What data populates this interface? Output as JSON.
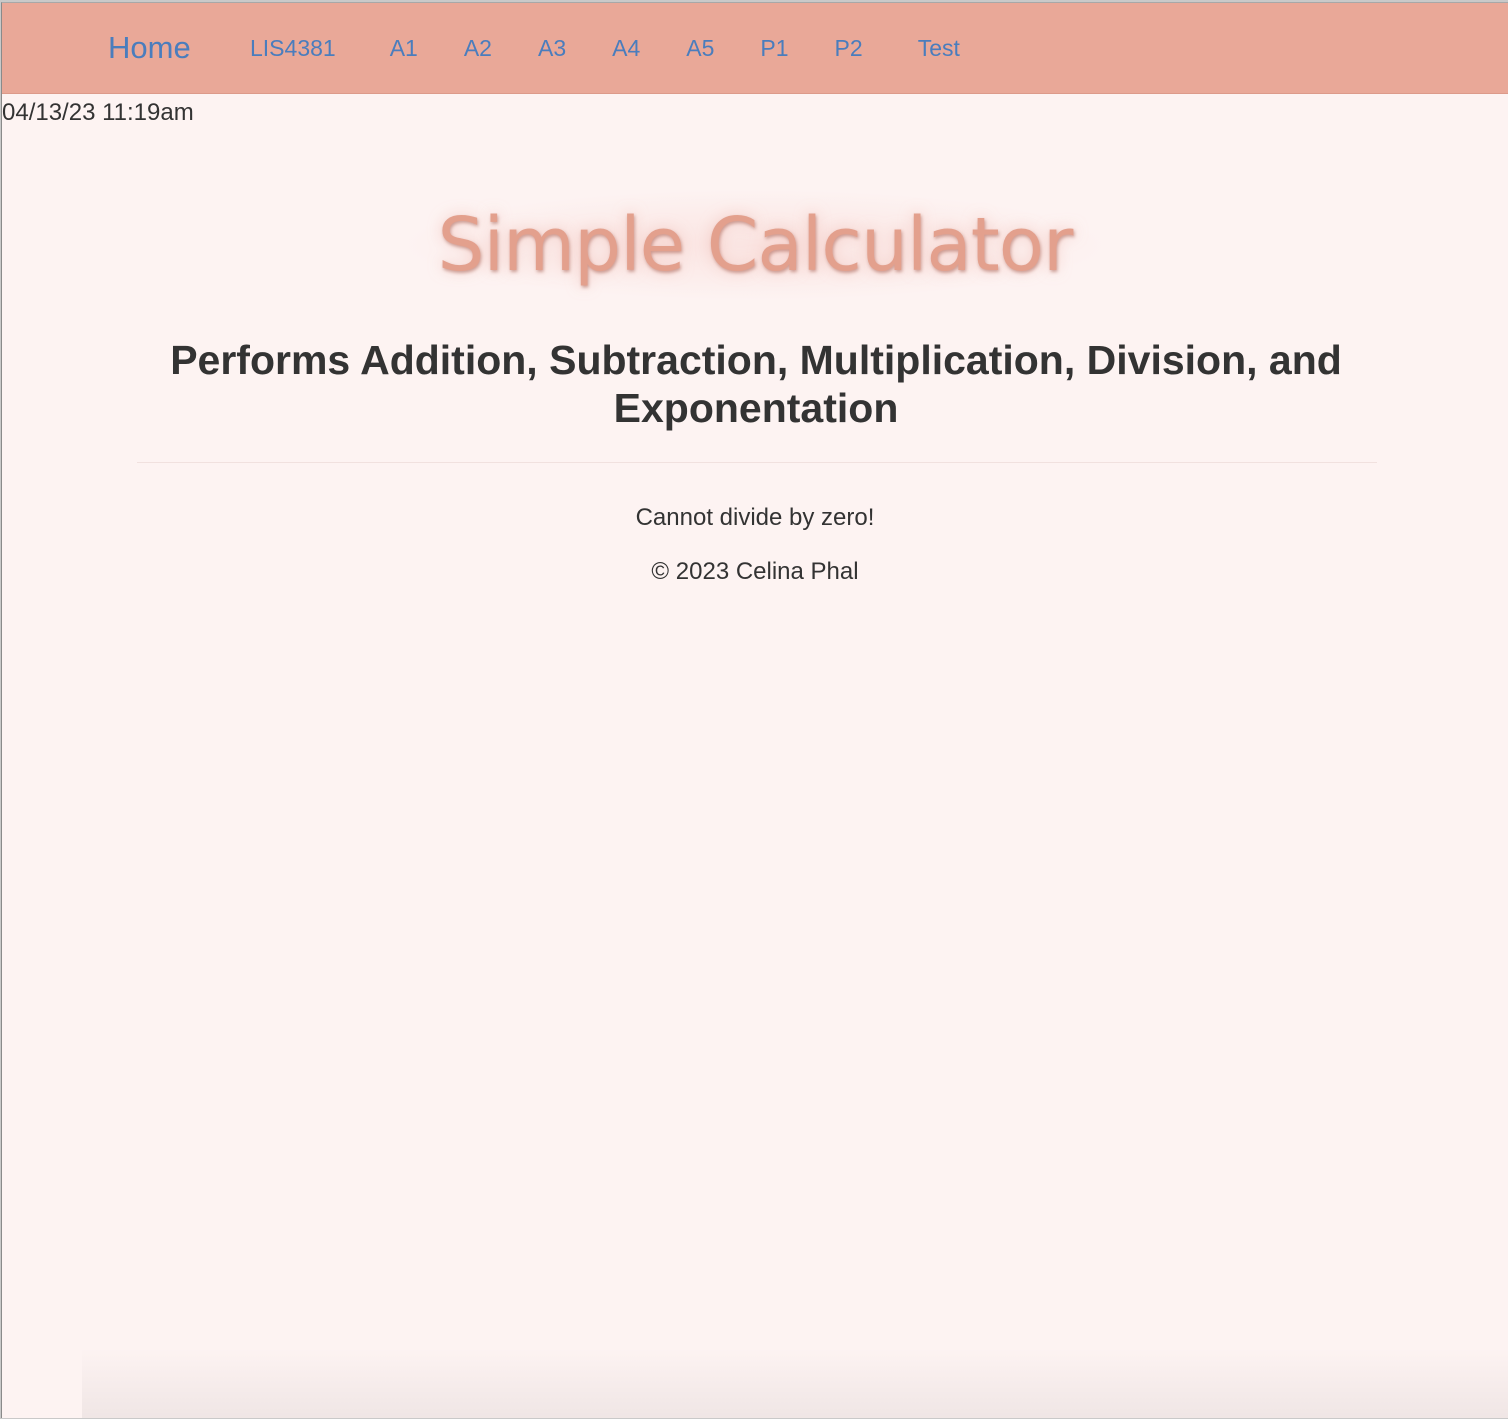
{
  "navbar": {
    "brand": "Home",
    "links": [
      {
        "label": "LIS4381"
      },
      {
        "label": "A1"
      },
      {
        "label": "A2"
      },
      {
        "label": "A3"
      },
      {
        "label": "A4"
      },
      {
        "label": "A5"
      },
      {
        "label": "P1"
      },
      {
        "label": "P2"
      },
      {
        "label": "Test"
      }
    ]
  },
  "timestamp": "04/13/23 11:19am",
  "main": {
    "title": "Simple Calculator",
    "subtitle": "Performs Addition, Subtraction, Multiplication, Division, and Exponentation",
    "message": "Cannot divide by zero!"
  },
  "footer": {
    "copyright": "© 2023 Celina Phal"
  },
  "colors": {
    "navbar_bg": "#e9a898",
    "page_bg": "#fdf3f2",
    "link": "#4a7dbd",
    "title": "#e3a08d",
    "text": "#333333"
  }
}
